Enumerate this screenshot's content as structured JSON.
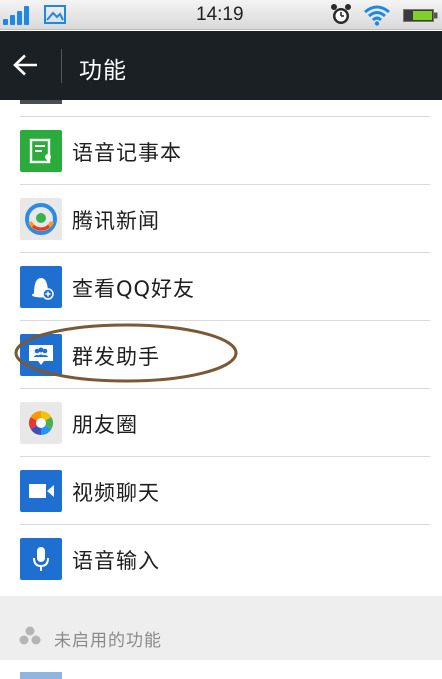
{
  "status_bar": {
    "time": "14:19"
  },
  "header": {
    "title": "功能"
  },
  "features": [
    {
      "label": "语音记事本",
      "icon": "notepad-icon",
      "color": "#2aab3b"
    },
    {
      "label": "腾讯新闻",
      "icon": "tencent-news-icon",
      "color": "#e8e8e8"
    },
    {
      "label": "查看QQ好友",
      "icon": "qq-friends-icon",
      "color": "#1e6fd0"
    },
    {
      "label": "群发助手",
      "icon": "mass-message-icon",
      "color": "#1e6fd0"
    },
    {
      "label": "朋友圈",
      "icon": "moments-icon",
      "color": "#e8e8e8"
    },
    {
      "label": "视频聊天",
      "icon": "video-chat-icon",
      "color": "#1e6fd0"
    },
    {
      "label": "语音输入",
      "icon": "voice-input-icon",
      "color": "#1e6fd0"
    }
  ],
  "disabled_section": {
    "title": "未启用的功能"
  },
  "colors": {
    "header_bg": "#1b2024",
    "annotation": "#7a5a36",
    "accent_blue": "#1e6fd0",
    "green": "#2aab3b"
  }
}
